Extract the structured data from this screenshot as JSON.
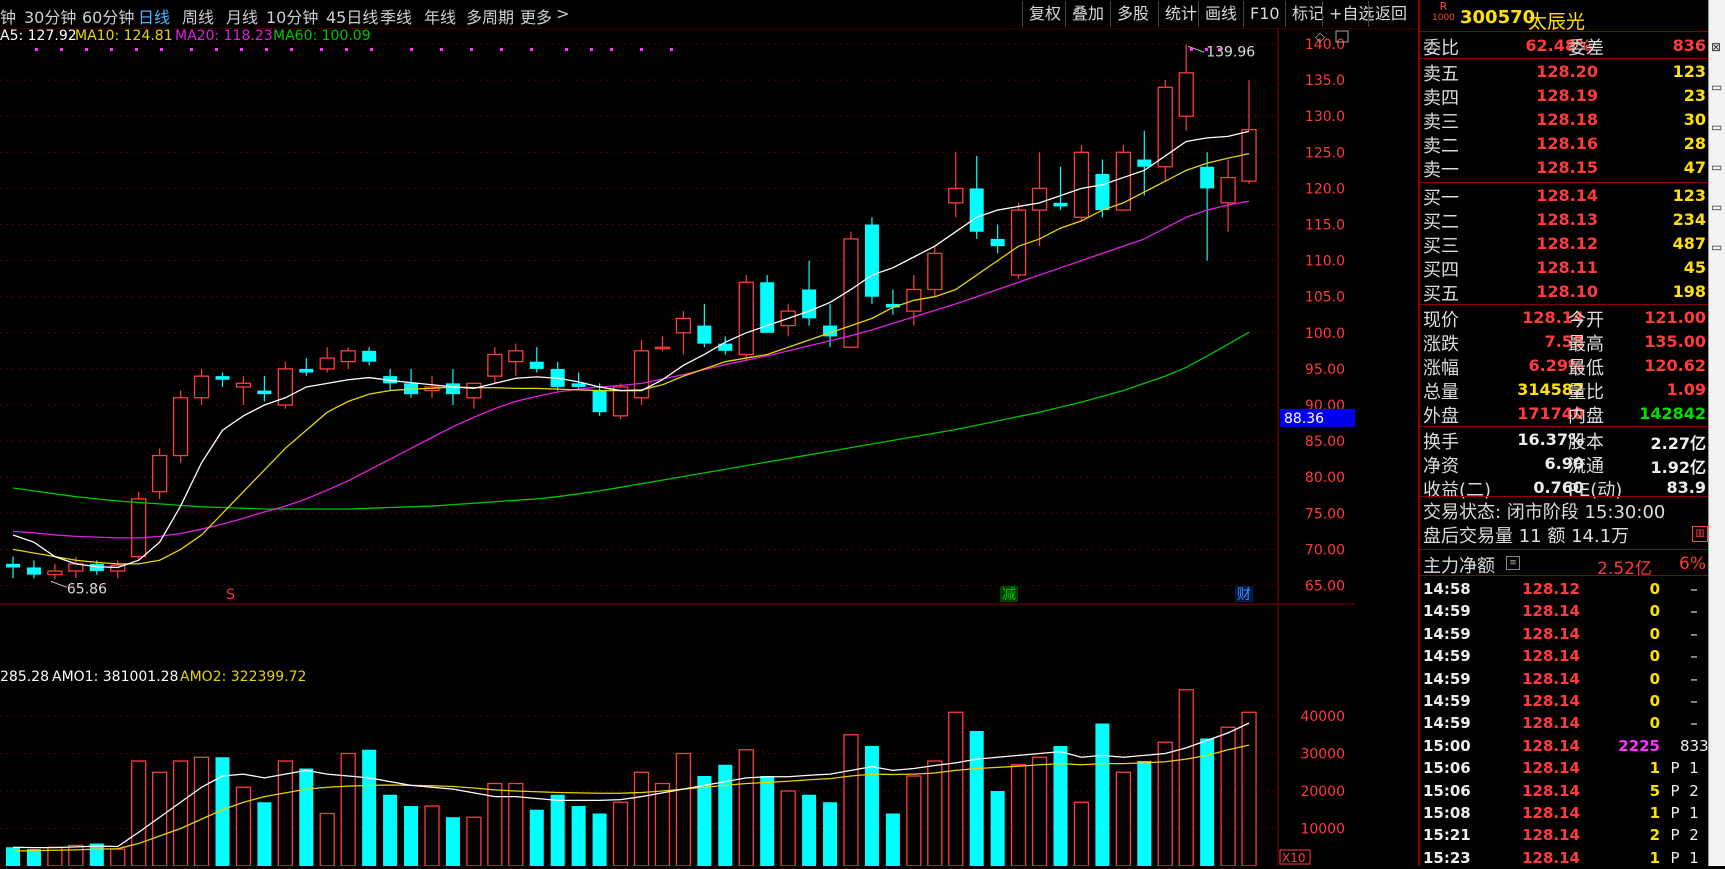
{
  "tabs": [
    {
      "label": "钟",
      "active": false
    },
    {
      "label": "30分钟",
      "active": false
    },
    {
      "label": "60分钟",
      "active": false
    },
    {
      "label": "日线",
      "active": true
    },
    {
      "label": "周线",
      "active": false
    },
    {
      "label": "月线",
      "active": false
    },
    {
      "label": "10分钟",
      "active": false
    },
    {
      "label": "45日线",
      "active": false
    },
    {
      "label": "季线",
      "active": false
    },
    {
      "label": "年线",
      "active": false
    },
    {
      "label": "多周期",
      "active": false
    },
    {
      "label": "更多",
      "active": false
    }
  ],
  "more_chevron": ">",
  "toolbar": [
    "复权",
    "叠加",
    "多股",
    "统计",
    "画线",
    "F10",
    "标记",
    "+自选",
    "返回"
  ],
  "ma_legend": {
    "ma5": "A5: 127.92",
    "ma10": "MA10: 124.81",
    "ma20": "MA20: 118.23",
    "ma60": "MA60: 100.09"
  },
  "vol_legend": {
    "vol": "285.28",
    "amo1": "AMO1: 381001.28",
    "amo2": "AMO2: 322399.72"
  },
  "price_labels": [
    "140.0",
    "135.0",
    "130.0",
    "125.0",
    "120.0",
    "115.0",
    "110.0",
    "105.0",
    "100.0",
    "95.00",
    "90.00",
    "85.00",
    "80.00",
    "75.00",
    "70.00",
    "65.00"
  ],
  "current_price_tag": "88.36",
  "high_mark": "139.96",
  "low_mark": "65.86",
  "event_marks": [
    {
      "text": "S",
      "color": "#ff3030"
    },
    {
      "text": "减",
      "color": "#00c000"
    },
    {
      "text": "财",
      "color": "#3a8cff"
    }
  ],
  "vol_labels": [
    "40000",
    "30000",
    "20000",
    "10000"
  ],
  "vol_unit": "X10",
  "colors": {
    "up": "#ff3b3b",
    "down": "#00ffff",
    "ma5": "#ffffff",
    "ma10": "#e6d400",
    "ma20": "#e21ee2",
    "ma60": "#00c400"
  },
  "chart_data": {
    "type": "candlestick",
    "ohlc": [
      [
        68,
        69,
        66,
        67.5
      ],
      [
        67.5,
        68.5,
        66,
        66.5
      ],
      [
        66.5,
        68,
        65.86,
        67
      ],
      [
        67,
        69,
        66,
        68
      ],
      [
        68,
        68.5,
        66.5,
        67
      ],
      [
        67,
        68.5,
        66,
        67.8
      ],
      [
        69,
        78,
        68.5,
        77
      ],
      [
        78,
        84,
        77,
        83
      ],
      [
        83,
        92,
        82,
        91
      ],
      [
        91,
        95,
        90,
        94
      ],
      [
        94,
        94.5,
        92.5,
        93.5
      ],
      [
        92.5,
        94,
        90,
        93
      ],
      [
        92,
        94,
        90.5,
        91.5
      ],
      [
        90,
        96,
        89.5,
        95
      ],
      [
        95,
        96.5,
        94,
        94.5
      ],
      [
        95,
        98,
        94.5,
        96.5
      ],
      [
        96,
        98,
        95,
        97.5
      ],
      [
        97.5,
        98,
        95.5,
        96
      ],
      [
        94,
        95,
        92,
        93
      ],
      [
        93,
        95,
        91,
        91.5
      ],
      [
        92,
        94,
        91,
        92.5
      ],
      [
        93,
        95,
        90,
        91.5
      ],
      [
        91,
        93,
        89.5,
        93
      ],
      [
        94,
        98,
        93,
        97
      ],
      [
        96,
        98.5,
        94,
        97.5
      ],
      [
        96,
        98,
        94.5,
        95
      ],
      [
        95,
        96,
        92,
        92.5
      ],
      [
        93,
        94.5,
        92,
        92.5
      ],
      [
        92,
        93,
        88.5,
        89
      ],
      [
        88.5,
        93,
        88,
        92.5
      ],
      [
        91,
        99,
        90,
        97.5
      ],
      [
        98,
        99.5,
        97.5,
        98
      ],
      [
        100,
        103,
        97,
        102
      ],
      [
        101,
        104,
        98,
        98.5
      ],
      [
        98.5,
        99.5,
        97,
        97.5
      ],
      [
        97,
        108,
        96,
        107
      ],
      [
        107,
        108,
        100,
        100
      ],
      [
        101,
        104,
        99.5,
        103
      ],
      [
        106,
        110,
        101,
        102
      ],
      [
        101,
        104,
        98,
        99.5
      ],
      [
        98,
        114,
        98,
        113
      ],
      [
        115,
        116,
        104,
        105
      ],
      [
        104,
        106,
        102.5,
        103.5
      ],
      [
        103,
        108,
        101,
        106
      ],
      [
        106,
        112,
        105,
        111
      ],
      [
        118,
        125,
        116,
        120
      ],
      [
        120,
        124.5,
        113,
        114
      ],
      [
        113,
        115,
        111,
        112
      ],
      [
        108,
        118,
        107.5,
        117
      ],
      [
        117,
        125,
        112,
        120
      ],
      [
        118,
        123,
        117,
        117.5
      ],
      [
        116,
        126,
        115.5,
        125
      ],
      [
        122,
        124,
        116,
        117
      ],
      [
        117,
        126,
        117,
        125
      ],
      [
        124,
        128,
        119,
        123
      ],
      [
        123,
        135,
        121,
        134
      ],
      [
        130,
        139.96,
        128,
        136
      ],
      [
        123,
        125,
        110,
        120
      ],
      [
        118,
        124,
        114,
        121.5
      ],
      [
        121,
        135,
        120.62,
        128.14
      ]
    ],
    "ma5": [
      72,
      71,
      69,
      68,
      67.6,
      67.5,
      68.5,
      71,
      76,
      82,
      86.5,
      88.5,
      90,
      91,
      92.5,
      93,
      93.5,
      93.8,
      93.4,
      93.1,
      92.8,
      92.5,
      92.3,
      93,
      93.7,
      93.9,
      93.7,
      93.2,
      92.5,
      92,
      92,
      93.5,
      95.5,
      97,
      98.7,
      100,
      101,
      102,
      103,
      104.2,
      106,
      108,
      109,
      110.5,
      112,
      114,
      116,
      117,
      117.5,
      118,
      119,
      120,
      120.5,
      121.5,
      122.5,
      124.5,
      126.5,
      127,
      127.2,
      127.92
    ],
    "ma10": [
      70,
      69.5,
      69,
      68.5,
      68.2,
      68,
      68,
      68.5,
      70,
      72,
      75,
      78,
      81,
      84,
      86.5,
      89,
      90.5,
      91.5,
      92,
      92.2,
      92.3,
      92.5,
      92.4,
      92.4,
      92.3,
      92.3,
      92.2,
      92.1,
      92,
      92,
      92.1,
      92.8,
      94,
      95,
      96,
      96.5,
      97,
      98,
      99,
      100,
      101,
      102,
      103.5,
      104.5,
      105,
      106,
      108,
      110,
      112,
      113,
      114.5,
      115.5,
      117,
      118,
      119.5,
      121,
      122.5,
      123.5,
      124.2,
      124.81
    ],
    "ma20": [
      72.5,
      72.3,
      72,
      71.8,
      71.7,
      71.6,
      71.6,
      71.8,
      72.2,
      72.8,
      73.5,
      74.3,
      75.2,
      76,
      77,
      78.2,
      79.5,
      81,
      82.5,
      84,
      85.5,
      87,
      88.3,
      89.5,
      90.5,
      91.2,
      91.8,
      92.2,
      92.5,
      92.7,
      93,
      93.6,
      94.2,
      94.9,
      95.6,
      96.2,
      96.8,
      97.5,
      98.2,
      98.9,
      99.6,
      100.4,
      101.3,
      102.2,
      103.1,
      104,
      105,
      106,
      107,
      108,
      109,
      110,
      111,
      112,
      113,
      114.5,
      116,
      117,
      117.7,
      118.23
    ],
    "ma60": [
      78.5,
      78.1,
      77.7,
      77.3,
      77,
      76.7,
      76.5,
      76.3,
      76.1,
      75.9,
      75.8,
      75.7,
      75.6,
      75.6,
      75.6,
      75.6,
      75.6,
      75.7,
      75.8,
      75.9,
      76,
      76.2,
      76.4,
      76.6,
      76.8,
      77,
      77.3,
      77.7,
      78.1,
      78.6,
      79.1,
      79.6,
      80.1,
      80.6,
      81.1,
      81.6,
      82.1,
      82.6,
      83.1,
      83.6,
      84.1,
      84.6,
      85.1,
      85.6,
      86.1,
      86.6,
      87.2,
      87.8,
      88.4,
      89,
      89.7,
      90.4,
      91.2,
      92,
      93,
      94,
      95.2,
      96.8,
      98.4,
      100.09
    ],
    "volume": [
      5000,
      4500,
      5000,
      5500,
      6000,
      4500,
      28000,
      25000,
      28000,
      29000,
      29000,
      21000,
      17000,
      28000,
      26000,
      14000,
      30000,
      31000,
      19000,
      16000,
      16000,
      13000,
      13000,
      22000,
      22000,
      15000,
      19000,
      16000,
      14000,
      17000,
      25000,
      22000,
      30000,
      24000,
      27000,
      31000,
      24000,
      20000,
      19000,
      17000,
      35000,
      32000,
      14000,
      24000,
      28000,
      41000,
      36000,
      20000,
      27000,
      29000,
      32000,
      17000,
      38000,
      25000,
      28000,
      33000,
      47000,
      34000,
      37000,
      41000
    ],
    "amo1": [
      5000,
      4900,
      4900,
      5100,
      5300,
      5200,
      9000,
      13000,
      17000,
      21000,
      24000,
      24500,
      23500,
      24500,
      25500,
      24500,
      24000,
      23500,
      22500,
      21500,
      21000,
      20500,
      19500,
      18500,
      18500,
      18000,
      17500,
      17500,
      17500,
      17700,
      18500,
      19500,
      20500,
      21500,
      22500,
      23500,
      23800,
      23800,
      24200,
      24500,
      25500,
      26500,
      25500,
      26000,
      26800,
      27500,
      28500,
      29000,
      29500,
      30000,
      30500,
      29000,
      29500,
      29000,
      29500,
      30000,
      31500,
      33500,
      35500,
      38100
    ],
    "amo2": [
      4000,
      4100,
      4200,
      4300,
      4500,
      4600,
      6000,
      8000,
      10000,
      12500,
      15000,
      17000,
      18500,
      19500,
      20500,
      21000,
      21300,
      21500,
      21600,
      21500,
      21400,
      21200,
      20800,
      20300,
      20000,
      19800,
      19600,
      19500,
      19400,
      19400,
      19600,
      20000,
      20500,
      21000,
      21500,
      22000,
      22300,
      22600,
      23000,
      23300,
      24000,
      24500,
      24400,
      24500,
      24800,
      25500,
      26000,
      26300,
      26600,
      27000,
      27300,
      27000,
      27300,
      27300,
      27500,
      27800,
      28500,
      29500,
      31000,
      32240
    ]
  },
  "panel": {
    "code": "300570",
    "name": "太辰光",
    "logo_top": "R",
    "logo_bottom": "1000",
    "weibi": {
      "l1": "委比",
      "v1": "62.48%",
      "l2": "委差",
      "v2": "836"
    },
    "asks": [
      {
        "label": "卖五",
        "price": "128.20",
        "vol": "123"
      },
      {
        "label": "卖四",
        "price": "128.19",
        "vol": "23"
      },
      {
        "label": "卖三",
        "price": "128.18",
        "vol": "30"
      },
      {
        "label": "卖二",
        "price": "128.16",
        "vol": "28"
      },
      {
        "label": "卖一",
        "price": "128.15",
        "vol": "47"
      }
    ],
    "bids": [
      {
        "label": "买一",
        "price": "128.14",
        "vol": "123"
      },
      {
        "label": "买二",
        "price": "128.13",
        "vol": "234"
      },
      {
        "label": "买三",
        "price": "128.12",
        "vol": "487"
      },
      {
        "label": "买四",
        "price": "128.11",
        "vol": "45"
      },
      {
        "label": "买五",
        "price": "128.10",
        "vol": "198"
      }
    ],
    "quote": [
      {
        "l1": "现价",
        "v1": "128.14",
        "c1": "red",
        "l2": "今开",
        "v2": "121.00",
        "c2": "red"
      },
      {
        "l1": "涨跌",
        "v1": "7.58",
        "c1": "red",
        "l2": "最高",
        "v2": "135.00",
        "c2": "red"
      },
      {
        "l1": "涨幅",
        "v1": "6.29%",
        "c1": "red",
        "l2": "最低",
        "v2": "120.62",
        "c2": "red"
      },
      {
        "l1": "总量",
        "v1": "314582",
        "c1": "yel",
        "l2": "量比",
        "v2": "1.09",
        "c2": "red"
      },
      {
        "l1": "外盘",
        "v1": "171740",
        "c1": "red",
        "l2": "内盘",
        "v2": "142842",
        "c2": "grn"
      }
    ],
    "stats": [
      {
        "l1": "换手",
        "v1": "16.37%",
        "l2": "股本",
        "v2": "2.27亿"
      },
      {
        "l1": "净资",
        "v1": "6.90",
        "l2": "流通",
        "v2": "1.92亿"
      },
      {
        "l1": "收益(二)",
        "v1": "0.760",
        "l2": "PE(动)",
        "v2": "83.9"
      }
    ],
    "trade_status": "交易状态: 闭市阶段 15:30:00",
    "after_hours": "盘后交易量 11 额 14.1万",
    "main_flow": {
      "label": "主力净额",
      "value": "2.52亿",
      "pct": "6%"
    },
    "ticks": [
      {
        "t": "14:58",
        "p": "128.12",
        "v": "0",
        "vc": "yel",
        "f": "",
        "n": "–"
      },
      {
        "t": "14:59",
        "p": "128.14",
        "v": "0",
        "vc": "yel",
        "f": "",
        "n": "–"
      },
      {
        "t": "14:59",
        "p": "128.14",
        "v": "0",
        "vc": "yel",
        "f": "",
        "n": "–"
      },
      {
        "t": "14:59",
        "p": "128.14",
        "v": "0",
        "vc": "yel",
        "f": "",
        "n": "–"
      },
      {
        "t": "14:59",
        "p": "128.14",
        "v": "0",
        "vc": "yel",
        "f": "",
        "n": "–"
      },
      {
        "t": "14:59",
        "p": "128.14",
        "v": "0",
        "vc": "yel",
        "f": "",
        "n": "–"
      },
      {
        "t": "14:59",
        "p": "128.14",
        "v": "0",
        "vc": "yel",
        "f": "",
        "n": "–"
      },
      {
        "t": "15:00",
        "p": "128.14",
        "v": "2225",
        "vc": "mag",
        "f": "",
        "n": "833"
      },
      {
        "t": "15:06",
        "p": "128.14",
        "v": "1",
        "vc": "yel",
        "f": "P",
        "n": "1"
      },
      {
        "t": "15:06",
        "p": "128.14",
        "v": "5",
        "vc": "yel",
        "f": "P",
        "n": "2"
      },
      {
        "t": "15:08",
        "p": "128.14",
        "v": "1",
        "vc": "yel",
        "f": "P",
        "n": "1"
      },
      {
        "t": "15:21",
        "p": "128.14",
        "v": "2",
        "vc": "yel",
        "f": "P",
        "n": "2"
      },
      {
        "t": "15:23",
        "p": "128.14",
        "v": "1",
        "vc": "yel",
        "f": "P",
        "n": "1"
      }
    ]
  }
}
